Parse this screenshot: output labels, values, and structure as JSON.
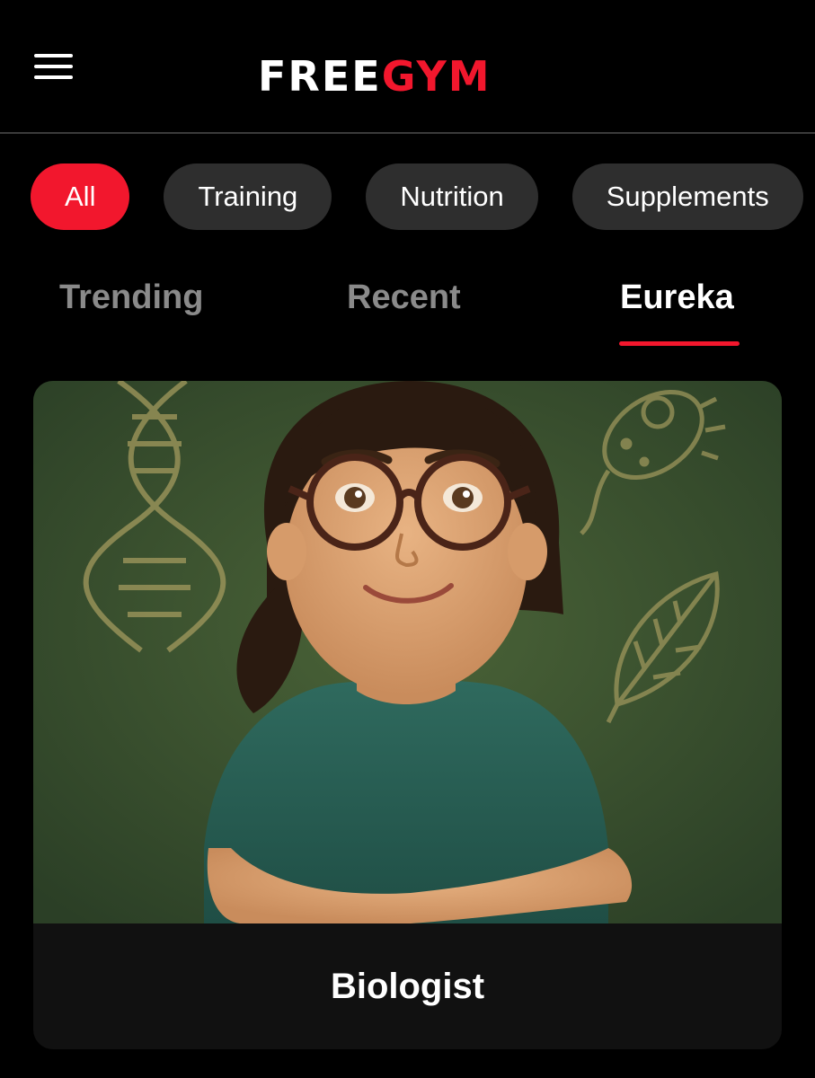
{
  "header": {
    "menu_icon": "hamburger-menu-icon",
    "logo_part_a": "FREE",
    "logo_part_b": "GYM"
  },
  "categories": [
    {
      "label": "All",
      "active": true
    },
    {
      "label": "Training",
      "active": false
    },
    {
      "label": "Nutrition",
      "active": false
    },
    {
      "label": "Supplements",
      "active": false
    }
  ],
  "tabs": [
    {
      "label": "Trending",
      "active": false
    },
    {
      "label": "Recent",
      "active": false
    },
    {
      "label": "Eureka",
      "active": true
    }
  ],
  "card": {
    "title": "Biologist",
    "image_subject": "illustration of a smiling woman with round glasses in front of a green chalkboard with biology doodles"
  },
  "colors": {
    "accent": "#f2172d",
    "chip_bg": "#2e2e2e",
    "background": "#000000",
    "card_bg": "#111111",
    "inactive_tab": "#8a8a8a"
  }
}
